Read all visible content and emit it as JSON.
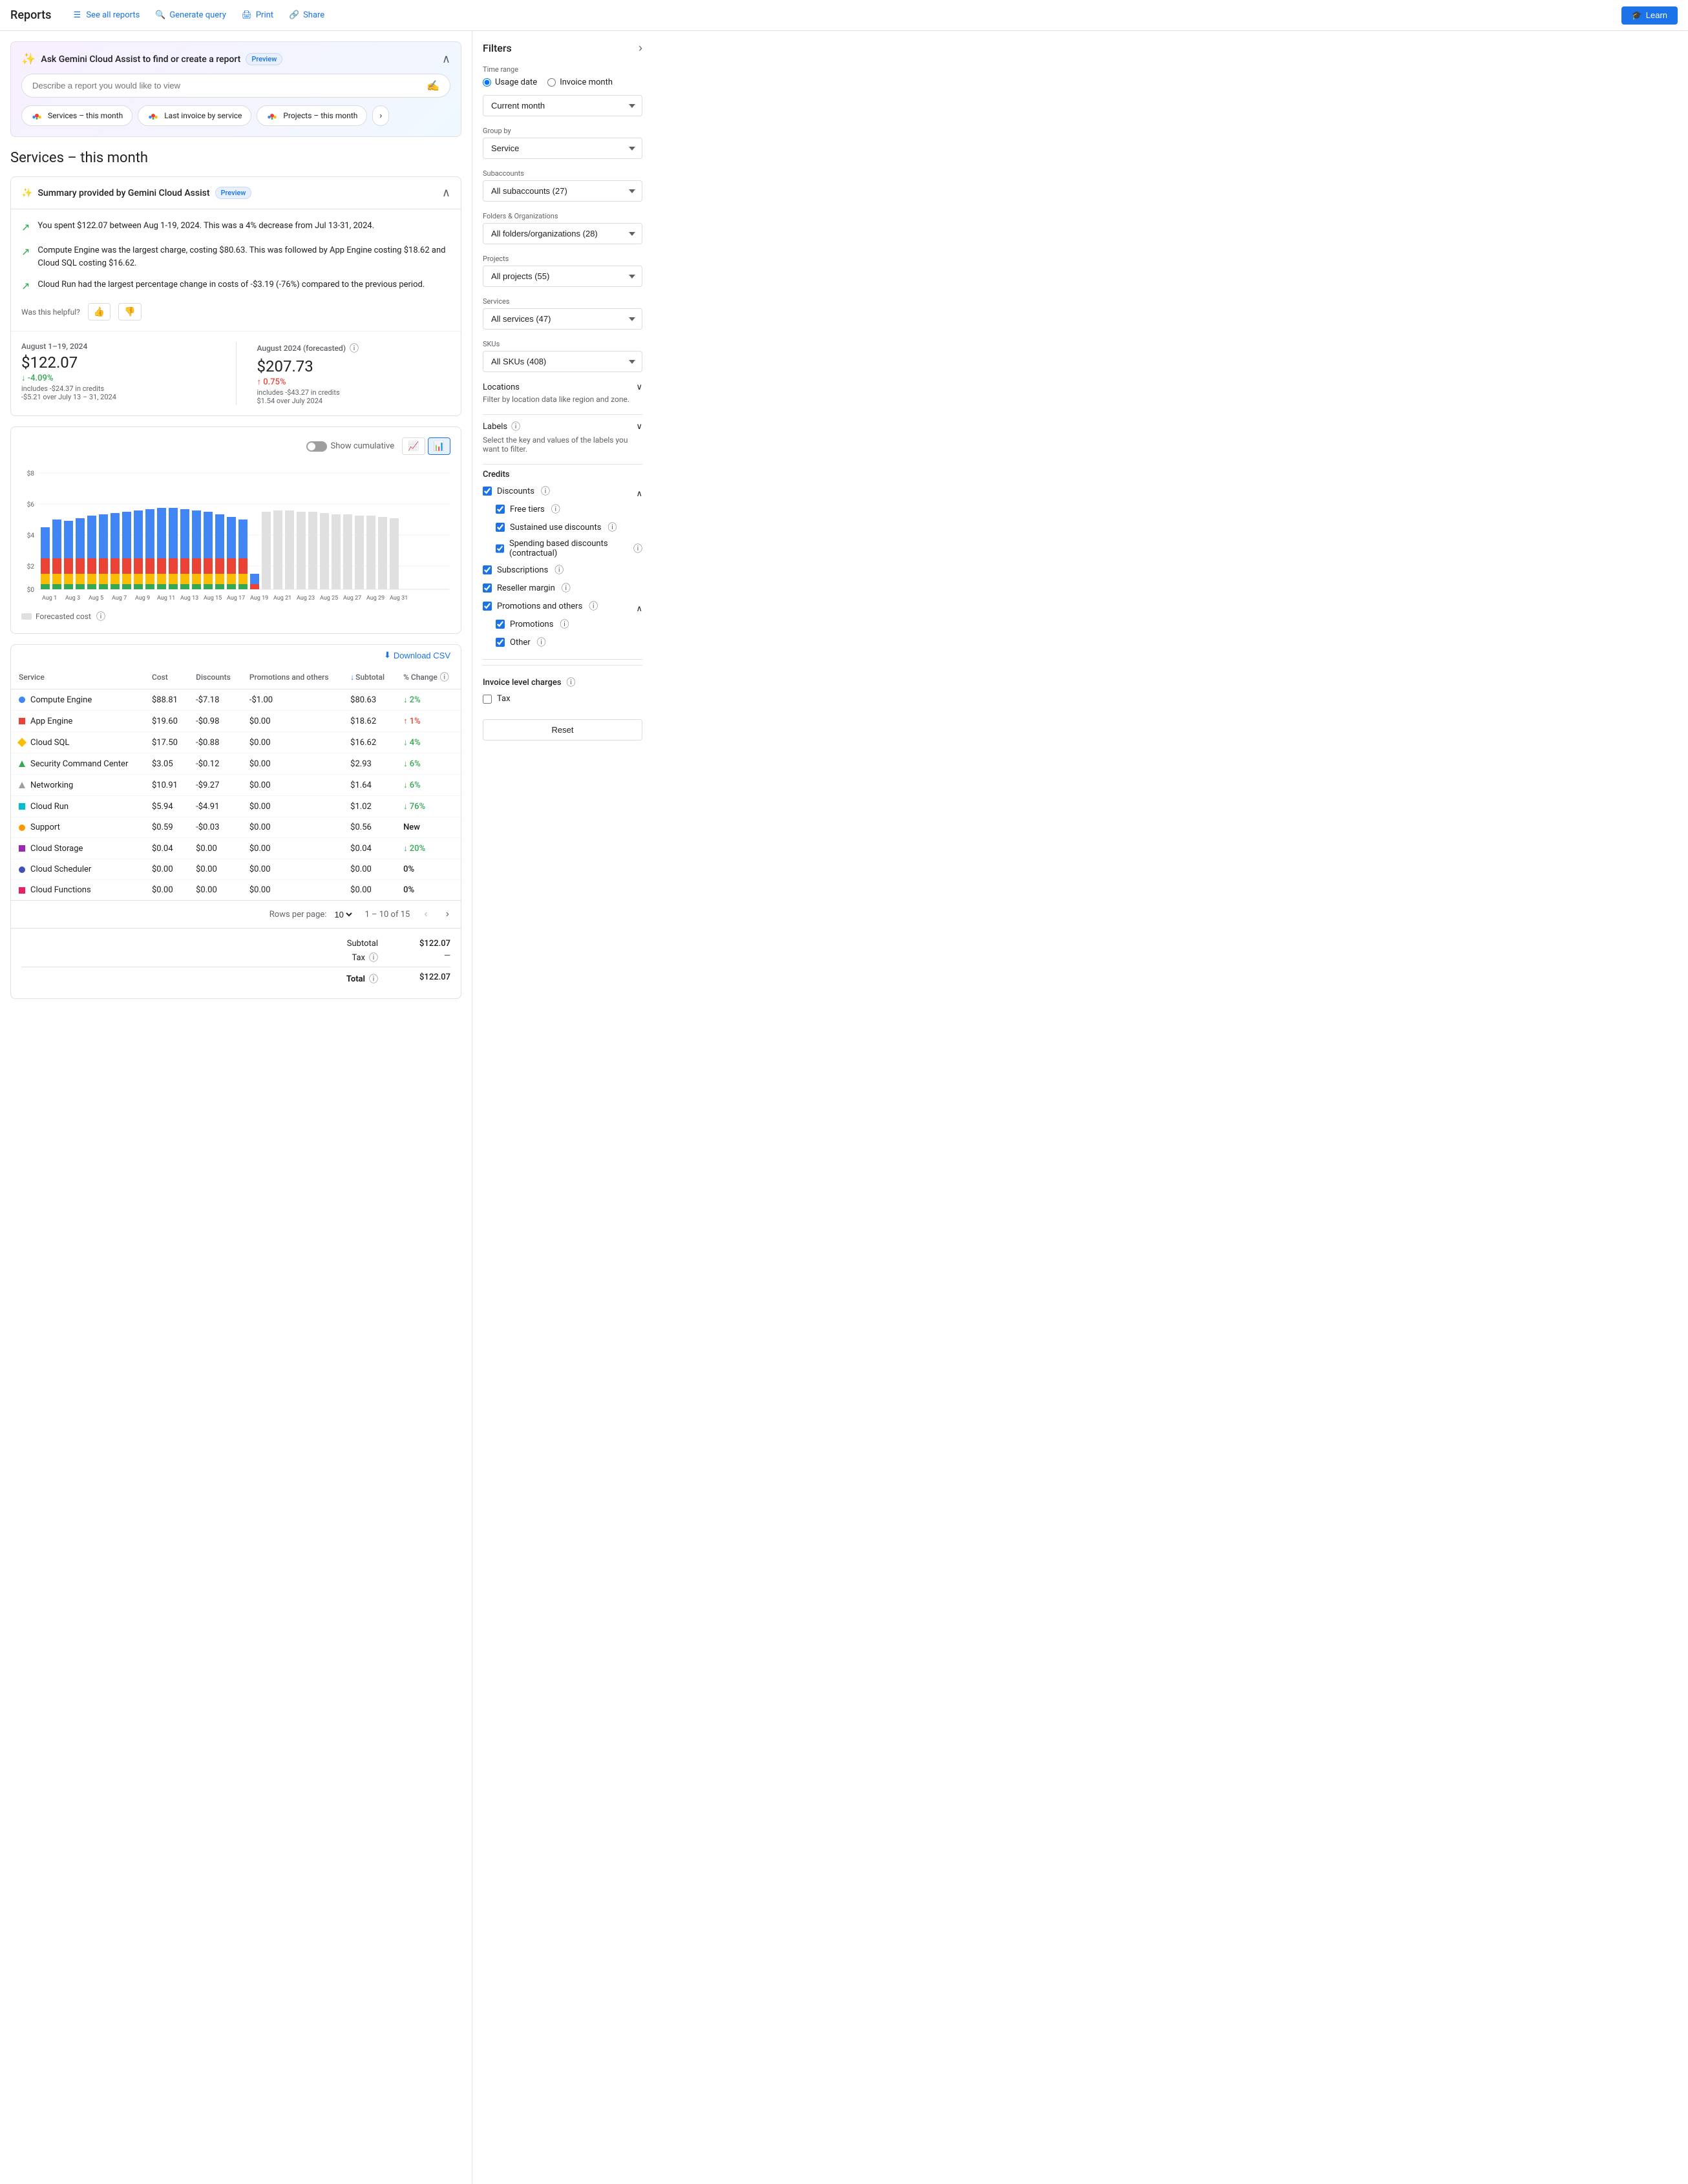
{
  "nav": {
    "title": "Reports",
    "links": [
      {
        "id": "see-all",
        "label": "See all reports",
        "icon": "list"
      },
      {
        "id": "generate-query",
        "label": "Generate query",
        "icon": "search"
      },
      {
        "id": "print",
        "label": "Print",
        "icon": "print"
      },
      {
        "id": "share",
        "label": "Share",
        "icon": "share"
      }
    ],
    "learn_label": "Learn"
  },
  "gemini": {
    "title": "Ask Gemini Cloud Assist to find or create a report",
    "preview": "Preview",
    "input_placeholder": "Describe a report you would like to view",
    "chips": [
      {
        "label": "Services – this month"
      },
      {
        "label": "Last invoice by service"
      },
      {
        "label": "Projects – this month"
      }
    ]
  },
  "page_title": "Services – this month",
  "summary": {
    "title": "Summary provided by Gemini Cloud Assist",
    "preview": "Preview",
    "items": [
      "You spent $122.07 between Aug 1-19, 2024. This was a 4% decrease from Jul 13-31, 2024.",
      "Compute Engine was the largest charge, costing $80.63. This was followed by App Engine costing $18.62 and Cloud SQL costing $16.62.",
      "Cloud Run had the largest percentage change in costs of -$3.19 (-76%) compared to the previous period."
    ],
    "feedback_label": "Was this helpful?"
  },
  "metrics": [
    {
      "period": "August 1–19, 2024",
      "value": "$122.07",
      "change": "↓ -4.09%",
      "change_type": "down",
      "sub": "includes -$24.37 in credits",
      "sub2": "-$5.21 over July 13 – 31, 2024"
    },
    {
      "period": "August 2024 (forecasted)",
      "value": "$207.73",
      "change": "↑ 0.75%",
      "change_type": "up",
      "sub": "includes -$43.27 in credits",
      "sub2": "$1.54 over July 2024"
    }
  ],
  "chart": {
    "show_cumulative": "Show cumulative",
    "y_labels": [
      "$8",
      "$6",
      "$4",
      "$2",
      "$0"
    ],
    "x_labels": [
      "Aug 1",
      "Aug 3",
      "Aug 5",
      "Aug 7",
      "Aug 9",
      "Aug 11",
      "Aug 13",
      "Aug 15",
      "Aug 17",
      "Aug 19",
      "Aug 21",
      "Aug 23",
      "Aug 25",
      "Aug 27",
      "Aug 29",
      "Aug 31"
    ],
    "forecast_label": "Forecasted cost"
  },
  "table": {
    "download_label": "Download CSV",
    "columns": [
      "Service",
      "Cost",
      "Discounts",
      "Promotions and others",
      "Subtotal",
      "% Change"
    ],
    "rows": [
      {
        "service": "Compute Engine",
        "color": "#4285f4",
        "shape": "circle",
        "cost": "$88.81",
        "discounts": "-$7.18",
        "promotions": "-$1.00",
        "subtotal": "$80.63",
        "change": "↓ 2%",
        "change_type": "down"
      },
      {
        "service": "App Engine",
        "color": "#ea4335",
        "shape": "square",
        "cost": "$19.60",
        "discounts": "-$0.98",
        "promotions": "$0.00",
        "subtotal": "$18.62",
        "change": "↑ 1%",
        "change_type": "up"
      },
      {
        "service": "Cloud SQL",
        "color": "#fbbc04",
        "shape": "diamond",
        "cost": "$17.50",
        "discounts": "-$0.88",
        "promotions": "$0.00",
        "subtotal": "$16.62",
        "change": "↓ 4%",
        "change_type": "down"
      },
      {
        "service": "Security Command Center",
        "color": "#34a853",
        "shape": "triangle",
        "cost": "$3.05",
        "discounts": "-$0.12",
        "promotions": "$0.00",
        "subtotal": "$2.93",
        "change": "↓ 6%",
        "change_type": "down"
      },
      {
        "service": "Networking",
        "color": "#9e9e9e",
        "shape": "triangle",
        "cost": "$10.91",
        "discounts": "-$9.27",
        "promotions": "$0.00",
        "subtotal": "$1.64",
        "change": "↓ 6%",
        "change_type": "down"
      },
      {
        "service": "Cloud Run",
        "color": "#00bcd4",
        "shape": "square",
        "cost": "$5.94",
        "discounts": "-$4.91",
        "promotions": "$0.00",
        "subtotal": "$1.02",
        "change": "↓ 76%",
        "change_type": "down"
      },
      {
        "service": "Support",
        "color": "#ff9800",
        "shape": "circle",
        "cost": "$0.59",
        "discounts": "-$0.03",
        "promotions": "$0.00",
        "subtotal": "$0.56",
        "change": "New",
        "change_type": "neutral"
      },
      {
        "service": "Cloud Storage",
        "color": "#9c27b0",
        "shape": "square",
        "cost": "$0.04",
        "discounts": "$0.00",
        "promotions": "$0.00",
        "subtotal": "$0.04",
        "change": "↓ 20%",
        "change_type": "down"
      },
      {
        "service": "Cloud Scheduler",
        "color": "#3f51b5",
        "shape": "circle",
        "cost": "$0.00",
        "discounts": "$0.00",
        "promotions": "$0.00",
        "subtotal": "$0.00",
        "change": "0%",
        "change_type": "neutral"
      },
      {
        "service": "Cloud Functions",
        "color": "#e91e63",
        "shape": "square",
        "cost": "$0.00",
        "discounts": "$0.00",
        "promotions": "$0.00",
        "subtotal": "$0.00",
        "change": "0%",
        "change_type": "neutral"
      }
    ],
    "pagination": {
      "rows_per_page": "10",
      "info": "1 – 10 of 15"
    },
    "totals": {
      "subtotal_label": "Subtotal",
      "subtotal_value": "$122.07",
      "tax_label": "Tax",
      "tax_value": "—",
      "total_label": "Total",
      "total_value": "$122.07"
    }
  },
  "filters": {
    "title": "Filters",
    "time_range": {
      "label": "Time range",
      "options": [
        "Usage date",
        "Invoice month"
      ],
      "selected": "Usage date",
      "period_options": [
        "Current month"
      ],
      "period_selected": "Current month"
    },
    "group_by": {
      "label": "Group by",
      "options": [
        "Service"
      ],
      "selected": "Service"
    },
    "subaccounts": {
      "label": "Subaccounts",
      "selected": "All subaccounts (27)"
    },
    "folders": {
      "label": "Folders & Organizations",
      "selected": "All folders/organizations (28)"
    },
    "projects": {
      "label": "Projects",
      "selected": "All projects (55)"
    },
    "services": {
      "label": "Services",
      "selected": "All services (47)"
    },
    "skus": {
      "label": "SKUs",
      "selected": "All SKUs (408)"
    },
    "locations": {
      "label": "Locations",
      "desc": "Filter by location data like region and zone."
    },
    "labels": {
      "label": "Labels",
      "desc": "Select the key and values of the labels you want to filter."
    },
    "credits": {
      "label": "Credits",
      "discounts": {
        "label": "Discounts",
        "checked": true,
        "children": [
          {
            "label": "Free tiers",
            "checked": true
          },
          {
            "label": "Sustained use discounts",
            "checked": true
          },
          {
            "label": "Spending based discounts (contractual)",
            "checked": true
          }
        ]
      },
      "subscriptions": {
        "label": "Subscriptions",
        "checked": true
      },
      "reseller_margin": {
        "label": "Reseller margin",
        "checked": true
      },
      "promotions_others": {
        "label": "Promotions and others",
        "checked": true,
        "children": [
          {
            "label": "Promotions",
            "checked": true
          },
          {
            "label": "Other",
            "checked": true
          }
        ]
      }
    },
    "invoice_charges": {
      "label": "Invoice level charges",
      "tax": {
        "label": "Tax",
        "checked": false
      }
    },
    "reset_label": "Reset"
  }
}
